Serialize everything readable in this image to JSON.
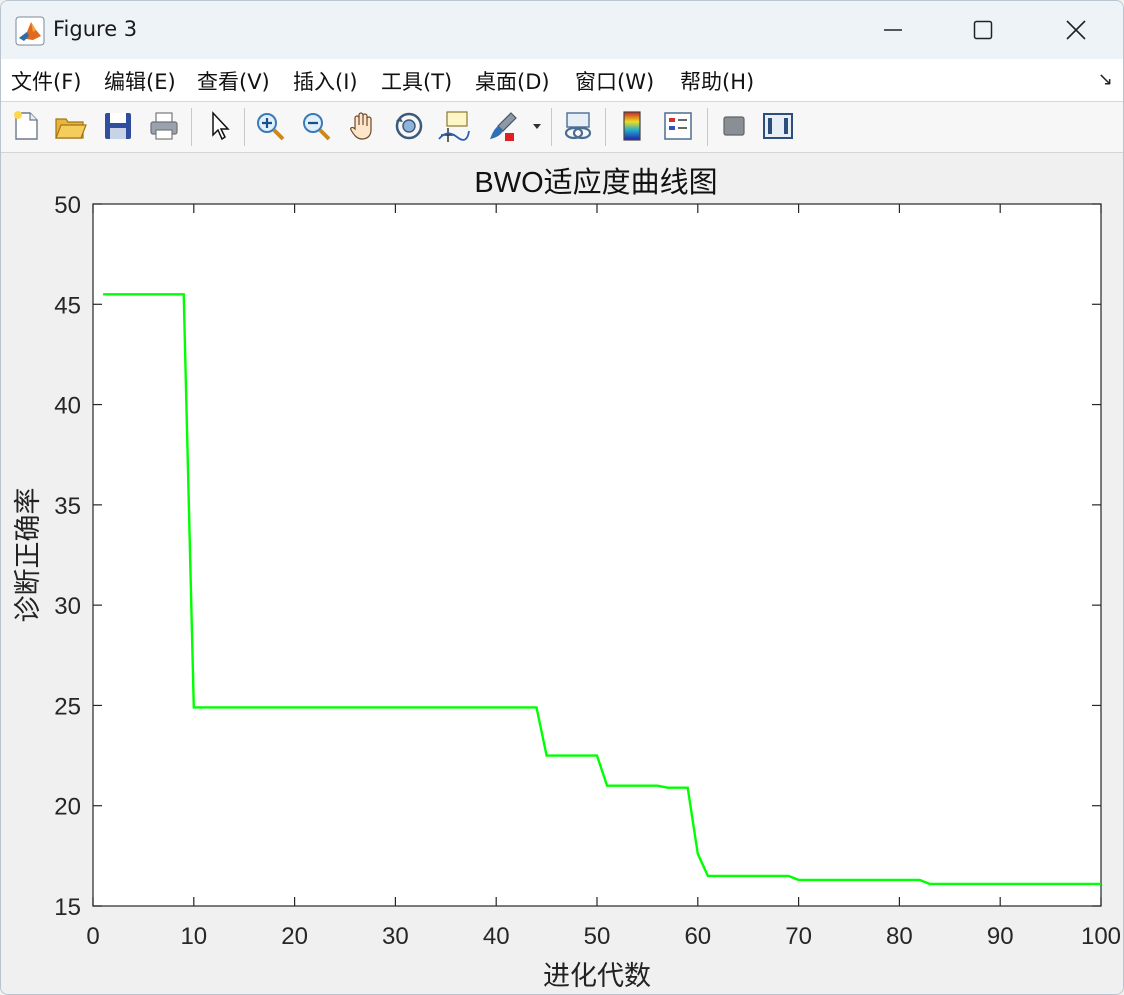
{
  "window": {
    "title": "Figure 3"
  },
  "menu": [
    "文件(F)",
    "编辑(E)",
    "查看(V)",
    "插入(I)",
    "工具(T)",
    "桌面(D)",
    "窗口(W)",
    "帮助(H)"
  ],
  "toolbar": [
    "new-figure-icon",
    "open-file-icon",
    "save-icon",
    "print-icon",
    "pointer-icon",
    "zoom-in-icon",
    "zoom-out-icon",
    "pan-hand-icon",
    "rotate-3d-icon",
    "data-cursor-icon",
    "brush-icon",
    "link-plot-icon",
    "insert-colorbar-icon",
    "insert-legend-icon",
    "hide-plot-tools-icon",
    "show-plot-tools-icon"
  ],
  "colors": {
    "line": "#00ff00",
    "axes_bg": "#ffffff",
    "figure_bg": "#f0f0f0"
  },
  "chart_data": {
    "type": "line",
    "title": "BWO适应度曲线图",
    "xlabel": "进化代数",
    "ylabel": "诊断正确率",
    "xlim": [
      0,
      100
    ],
    "ylim": [
      15,
      50
    ],
    "xticks": [
      "0",
      "10",
      "20",
      "30",
      "40",
      "50",
      "60",
      "70",
      "80",
      "90",
      "100"
    ],
    "yticks": [
      "15",
      "20",
      "25",
      "30",
      "35",
      "40",
      "45",
      "50"
    ],
    "grid": false,
    "series": [
      {
        "x": [
          1,
          9,
          10,
          44,
          45,
          50,
          51,
          56,
          57,
          59,
          60,
          61,
          69,
          70,
          82,
          83,
          100
        ],
        "y": [
          45.5,
          45.5,
          24.9,
          24.9,
          22.5,
          22.5,
          21.0,
          21.0,
          20.9,
          20.9,
          17.6,
          16.5,
          16.5,
          16.3,
          16.3,
          16.1,
          16.1
        ]
      }
    ]
  }
}
